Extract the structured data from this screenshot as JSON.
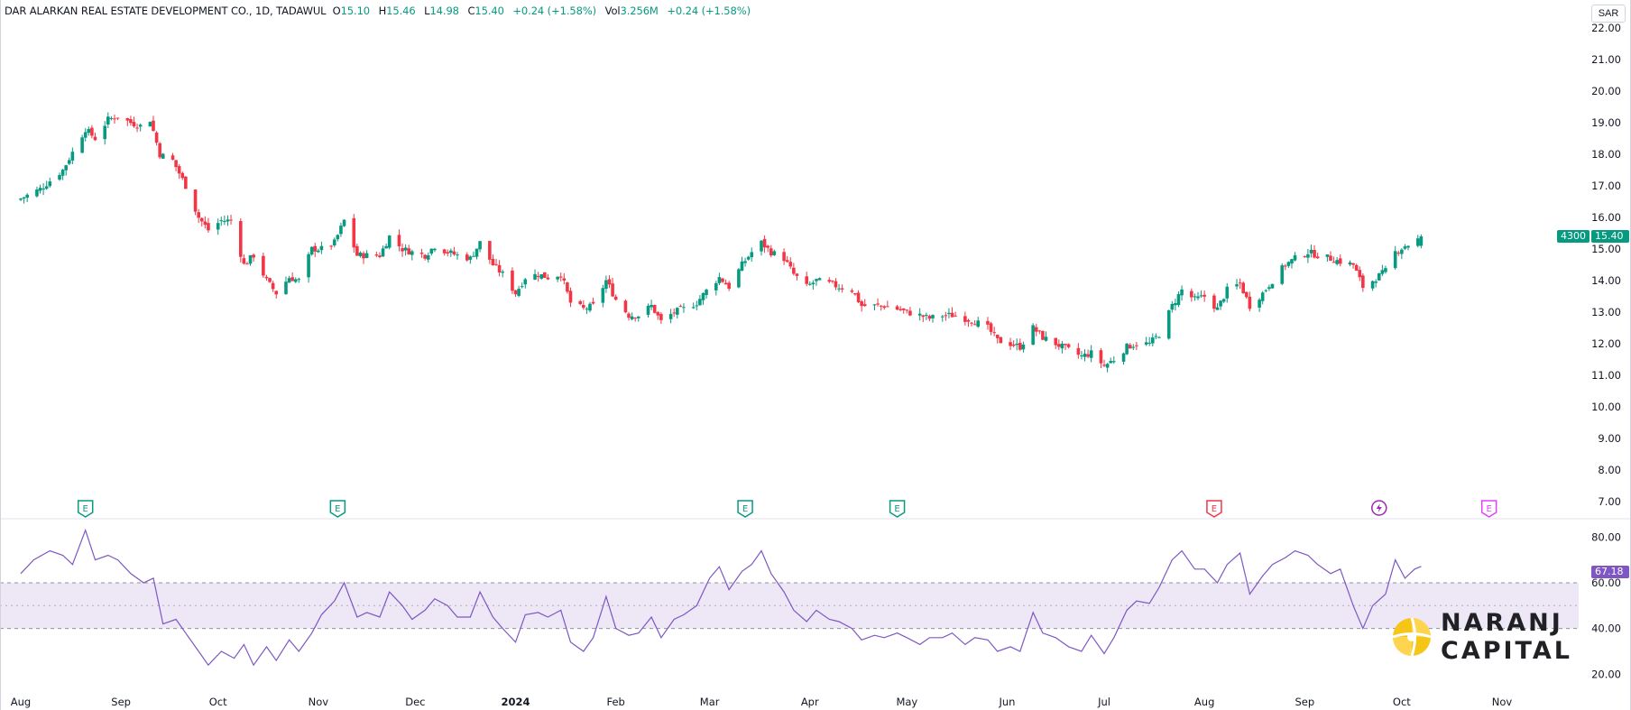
{
  "header": {
    "symbol": "DAR ALARKAN REAL ESTATE DEVELOPMENT CO., 1D, TADAWUL",
    "open_label": "O",
    "open": "15.10",
    "high_label": "H",
    "high": "15.46",
    "low_label": "L",
    "low": "14.98",
    "close_label": "C",
    "close": "15.40",
    "change": "+0.24 (+1.58%)",
    "vol_label": "Vol",
    "vol": "3.256M",
    "vol_change": "+0.24 (+1.58%)"
  },
  "currency": "SAR",
  "price_tag": {
    "ticker": "4300",
    "last": "15.40"
  },
  "rsi_tag": "67.18",
  "brand": {
    "line1": "NARANJ",
    "line2": "CAPITAL"
  },
  "colors": {
    "up": "#089981",
    "down": "#f23645",
    "rsi": "#7e57c2",
    "band": "#ede7f6",
    "event_e_green": "#089981",
    "event_e_red": "#f23645",
    "event_e_magenta": "#e040fb",
    "event_split": "#9c27b0",
    "logo_yellow": "#f5c518"
  },
  "events": [
    {
      "date": "2023-08-21",
      "kind": "E",
      "color": "green"
    },
    {
      "date": "2023-11-07",
      "kind": "E",
      "color": "green"
    },
    {
      "date": "2024-03-12",
      "kind": "E",
      "color": "green"
    },
    {
      "date": "2024-04-28",
      "kind": "E",
      "color": "green"
    },
    {
      "date": "2024-08-04",
      "kind": "E",
      "color": "red"
    },
    {
      "date": "2024-09-24",
      "kind": "dividend-icon",
      "color": "purple"
    },
    {
      "date": "2024-10-28",
      "kind": "E",
      "color": "magenta"
    }
  ],
  "chart_data": [
    {
      "type": "candlestick",
      "title": "DAR ALARKAN REAL ESTATE DEVELOPMENT CO., 1D, TADAWUL",
      "ylim": [
        7,
        22
      ],
      "yticks": [
        "22.00",
        "21.00",
        "20.00",
        "19.00",
        "18.00",
        "17.00",
        "16.00",
        "15.00",
        "14.00",
        "13.00",
        "12.00",
        "11.00",
        "10.00",
        "9.00",
        "8.00",
        "7.00"
      ],
      "xticks": [
        {
          "label": "Aug",
          "date": "2023-08-01"
        },
        {
          "label": "Sep",
          "date": "2023-09-01"
        },
        {
          "label": "Oct",
          "date": "2023-10-01"
        },
        {
          "label": "Nov",
          "date": "2023-11-01"
        },
        {
          "label": "Dec",
          "date": "2023-12-01"
        },
        {
          "label": "2024",
          "date": "2024-01-01"
        },
        {
          "label": "Feb",
          "date": "2024-02-01"
        },
        {
          "label": "Mar",
          "date": "2024-03-01"
        },
        {
          "label": "Apr",
          "date": "2024-04-01"
        },
        {
          "label": "May",
          "date": "2024-05-01"
        },
        {
          "label": "Jun",
          "date": "2024-06-01"
        },
        {
          "label": "Jul",
          "date": "2024-07-01"
        },
        {
          "label": "Aug",
          "date": "2024-08-01"
        },
        {
          "label": "Sep",
          "date": "2024-09-01"
        },
        {
          "label": "Oct",
          "date": "2024-10-01"
        },
        {
          "label": "Nov",
          "date": "2024-11-01"
        }
      ],
      "close_path": [
        [
          "2023-08-01",
          16.6
        ],
        [
          "2023-08-07",
          16.9
        ],
        [
          "2023-08-14",
          17.5
        ],
        [
          "2023-08-21",
          18.8
        ],
        [
          "2023-08-24",
          18.5
        ],
        [
          "2023-08-28",
          19.1
        ],
        [
          "2023-08-31",
          19.2
        ],
        [
          "2023-09-04",
          19.0
        ],
        [
          "2023-09-07",
          18.9
        ],
        [
          "2023-09-10",
          19.1
        ],
        [
          "2023-09-13",
          18.0
        ],
        [
          "2023-09-17",
          17.8
        ],
        [
          "2023-09-21",
          17.0
        ],
        [
          "2023-09-25",
          16.0
        ],
        [
          "2023-09-28",
          15.6
        ],
        [
          "2023-10-02",
          15.9
        ],
        [
          "2023-10-05",
          15.9
        ],
        [
          "2023-10-09",
          14.5
        ],
        [
          "2023-10-12",
          14.8
        ],
        [
          "2023-10-16",
          14.0
        ],
        [
          "2023-10-19",
          13.6
        ],
        [
          "2023-10-23",
          14.1
        ],
        [
          "2023-10-26",
          14.0
        ],
        [
          "2023-10-30",
          15.0
        ],
        [
          "2023-11-02",
          15.0
        ],
        [
          "2023-11-06",
          15.2
        ],
        [
          "2023-11-09",
          15.9
        ],
        [
          "2023-11-13",
          14.8
        ],
        [
          "2023-11-16",
          14.8
        ],
        [
          "2023-11-20",
          14.8
        ],
        [
          "2023-11-23",
          15.4
        ],
        [
          "2023-11-27",
          15.0
        ],
        [
          "2023-11-30",
          14.9
        ],
        [
          "2023-12-04",
          14.8
        ],
        [
          "2023-12-07",
          15.1
        ],
        [
          "2023-12-11",
          14.9
        ],
        [
          "2023-12-14",
          14.8
        ],
        [
          "2023-12-18",
          14.7
        ],
        [
          "2023-12-21",
          15.2
        ],
        [
          "2023-12-25",
          14.5
        ],
        [
          "2023-12-28",
          14.2
        ],
        [
          "2024-01-01",
          13.6
        ],
        [
          "2024-01-04",
          14.1
        ],
        [
          "2024-01-08",
          14.2
        ],
        [
          "2024-01-11",
          14.1
        ],
        [
          "2024-01-15",
          14.2
        ],
        [
          "2024-01-18",
          13.3
        ],
        [
          "2024-01-22",
          13.1
        ],
        [
          "2024-01-25",
          13.2
        ],
        [
          "2024-01-29",
          14.0
        ],
        [
          "2024-02-01",
          13.4
        ],
        [
          "2024-02-05",
          12.9
        ],
        [
          "2024-02-08",
          12.9
        ],
        [
          "2024-02-12",
          13.2
        ],
        [
          "2024-02-15",
          12.7
        ],
        [
          "2024-02-19",
          13.0
        ],
        [
          "2024-02-22",
          13.1
        ],
        [
          "2024-02-26",
          13.3
        ],
        [
          "2024-03-01",
          13.8
        ],
        [
          "2024-03-04",
          14.1
        ],
        [
          "2024-03-07",
          13.8
        ],
        [
          "2024-03-11",
          14.5
        ],
        [
          "2024-03-14",
          14.9
        ],
        [
          "2024-03-17",
          15.2
        ],
        [
          "2024-03-20",
          14.9
        ],
        [
          "2024-03-24",
          14.7
        ],
        [
          "2024-03-27",
          14.2
        ],
        [
          "2024-03-31",
          13.8
        ],
        [
          "2024-04-03",
          14.0
        ],
        [
          "2024-04-07",
          13.9
        ],
        [
          "2024-04-10",
          13.8
        ],
        [
          "2024-04-14",
          13.7
        ],
        [
          "2024-04-17",
          13.2
        ],
        [
          "2024-04-21",
          13.2
        ],
        [
          "2024-04-24",
          13.2
        ],
        [
          "2024-04-28",
          13.1
        ],
        [
          "2024-05-01",
          13.0
        ],
        [
          "2024-05-05",
          12.9
        ],
        [
          "2024-05-08",
          12.8
        ],
        [
          "2024-05-12",
          12.9
        ],
        [
          "2024-05-15",
          12.9
        ],
        [
          "2024-05-19",
          12.8
        ],
        [
          "2024-05-22",
          12.7
        ],
        [
          "2024-05-26",
          12.5
        ],
        [
          "2024-05-29",
          12.1
        ],
        [
          "2024-06-02",
          12.0
        ],
        [
          "2024-06-05",
          11.9
        ],
        [
          "2024-06-09",
          12.5
        ],
        [
          "2024-06-12",
          12.2
        ],
        [
          "2024-06-16",
          12.0
        ],
        [
          "2024-06-20",
          11.8
        ],
        [
          "2024-06-24",
          11.6
        ],
        [
          "2024-06-27",
          11.7
        ],
        [
          "2024-07-01",
          11.3
        ],
        [
          "2024-07-04",
          11.5
        ],
        [
          "2024-07-08",
          11.9
        ],
        [
          "2024-07-11",
          12.0
        ],
        [
          "2024-07-15",
          12.0
        ],
        [
          "2024-07-18",
          12.3
        ],
        [
          "2024-07-22",
          13.2
        ],
        [
          "2024-07-25",
          13.7
        ],
        [
          "2024-07-29",
          13.4
        ],
        [
          "2024-08-01",
          13.5
        ],
        [
          "2024-08-05",
          13.1
        ],
        [
          "2024-08-08",
          13.7
        ],
        [
          "2024-08-12",
          13.9
        ],
        [
          "2024-08-15",
          13.2
        ],
        [
          "2024-08-19",
          13.6
        ],
        [
          "2024-08-22",
          14.0
        ],
        [
          "2024-08-26",
          14.5
        ],
        [
          "2024-08-29",
          14.7
        ],
        [
          "2024-09-02",
          14.9
        ],
        [
          "2024-09-05",
          14.8
        ],
        [
          "2024-09-09",
          14.7
        ],
        [
          "2024-09-12",
          14.6
        ],
        [
          "2024-09-16",
          14.5
        ],
        [
          "2024-09-19",
          13.8
        ],
        [
          "2024-09-22",
          14.0
        ],
        [
          "2024-09-26",
          14.3
        ],
        [
          "2024-09-29",
          14.9
        ],
        [
          "2024-10-02",
          15.1
        ],
        [
          "2024-10-05",
          15.2
        ],
        [
          "2024-10-07",
          15.4
        ]
      ],
      "last_close": 15.4
    },
    {
      "type": "line",
      "title": "RSI",
      "ylim": [
        15,
        88
      ],
      "yticks": [
        "80.00",
        "60.00",
        "40.00",
        "20.00"
      ],
      "band": [
        40,
        60
      ],
      "midline": 50,
      "last_value": 67.18,
      "values": [
        [
          "2023-08-01",
          64
        ],
        [
          "2023-08-05",
          70
        ],
        [
          "2023-08-10",
          74
        ],
        [
          "2023-08-14",
          72
        ],
        [
          "2023-08-17",
          68
        ],
        [
          "2023-08-21",
          83
        ],
        [
          "2023-08-24",
          70
        ],
        [
          "2023-08-28",
          72
        ],
        [
          "2023-08-31",
          70
        ],
        [
          "2023-09-04",
          64
        ],
        [
          "2023-09-08",
          60
        ],
        [
          "2023-09-11",
          62
        ],
        [
          "2023-09-14",
          42
        ],
        [
          "2023-09-18",
          44
        ],
        [
          "2023-09-21",
          38
        ],
        [
          "2023-09-25",
          30
        ],
        [
          "2023-09-28",
          24
        ],
        [
          "2023-10-02",
          30
        ],
        [
          "2023-10-06",
          27
        ],
        [
          "2023-10-09",
          33
        ],
        [
          "2023-10-12",
          24
        ],
        [
          "2023-10-16",
          32
        ],
        [
          "2023-10-19",
          26
        ],
        [
          "2023-10-23",
          35
        ],
        [
          "2023-10-26",
          30
        ],
        [
          "2023-10-30",
          38
        ],
        [
          "2023-11-02",
          46
        ],
        [
          "2023-11-06",
          52
        ],
        [
          "2023-11-09",
          60
        ],
        [
          "2023-11-13",
          45
        ],
        [
          "2023-11-16",
          47
        ],
        [
          "2023-11-20",
          45
        ],
        [
          "2023-11-23",
          56
        ],
        [
          "2023-11-27",
          50
        ],
        [
          "2023-11-30",
          44
        ],
        [
          "2023-12-04",
          48
        ],
        [
          "2023-12-07",
          53
        ],
        [
          "2023-12-11",
          50
        ],
        [
          "2023-12-14",
          45
        ],
        [
          "2023-12-18",
          45
        ],
        [
          "2023-12-21",
          56
        ],
        [
          "2023-12-25",
          45
        ],
        [
          "2023-12-28",
          40
        ],
        [
          "2024-01-01",
          34
        ],
        [
          "2024-01-04",
          46
        ],
        [
          "2024-01-08",
          47
        ],
        [
          "2024-01-11",
          45
        ],
        [
          "2024-01-15",
          48
        ],
        [
          "2024-01-18",
          34
        ],
        [
          "2024-01-22",
          30
        ],
        [
          "2024-01-25",
          36
        ],
        [
          "2024-01-29",
          54
        ],
        [
          "2024-02-01",
          40
        ],
        [
          "2024-02-05",
          37
        ],
        [
          "2024-02-08",
          38
        ],
        [
          "2024-02-12",
          45
        ],
        [
          "2024-02-15",
          36
        ],
        [
          "2024-02-19",
          44
        ],
        [
          "2024-02-22",
          46
        ],
        [
          "2024-02-26",
          50
        ],
        [
          "2024-03-01",
          62
        ],
        [
          "2024-03-04",
          67
        ],
        [
          "2024-03-07",
          57
        ],
        [
          "2024-03-11",
          65
        ],
        [
          "2024-03-14",
          68
        ],
        [
          "2024-03-17",
          74
        ],
        [
          "2024-03-20",
          64
        ],
        [
          "2024-03-24",
          56
        ],
        [
          "2024-03-27",
          48
        ],
        [
          "2024-03-31",
          43
        ],
        [
          "2024-04-03",
          48
        ],
        [
          "2024-04-07",
          44
        ],
        [
          "2024-04-10",
          43
        ],
        [
          "2024-04-14",
          40
        ],
        [
          "2024-04-17",
          35
        ],
        [
          "2024-04-21",
          37
        ],
        [
          "2024-04-24",
          36
        ],
        [
          "2024-04-28",
          38
        ],
        [
          "2024-05-01",
          36
        ],
        [
          "2024-05-05",
          33
        ],
        [
          "2024-05-08",
          36
        ],
        [
          "2024-05-12",
          36
        ],
        [
          "2024-05-15",
          38
        ],
        [
          "2024-05-19",
          33
        ],
        [
          "2024-05-22",
          36
        ],
        [
          "2024-05-26",
          35
        ],
        [
          "2024-05-29",
          30
        ],
        [
          "2024-06-02",
          32
        ],
        [
          "2024-06-05",
          30
        ],
        [
          "2024-06-09",
          47
        ],
        [
          "2024-06-12",
          38
        ],
        [
          "2024-06-16",
          36
        ],
        [
          "2024-06-20",
          32
        ],
        [
          "2024-06-24",
          30
        ],
        [
          "2024-06-27",
          37
        ],
        [
          "2024-07-01",
          29
        ],
        [
          "2024-07-04",
          36
        ],
        [
          "2024-07-08",
          48
        ],
        [
          "2024-07-11",
          52
        ],
        [
          "2024-07-15",
          51
        ],
        [
          "2024-07-18",
          58
        ],
        [
          "2024-07-22",
          70
        ],
        [
          "2024-07-25",
          74
        ],
        [
          "2024-07-29",
          66
        ],
        [
          "2024-08-01",
          66
        ],
        [
          "2024-08-05",
          60
        ],
        [
          "2024-08-08",
          68
        ],
        [
          "2024-08-12",
          73
        ],
        [
          "2024-08-15",
          55
        ],
        [
          "2024-08-19",
          63
        ],
        [
          "2024-08-22",
          68
        ],
        [
          "2024-08-26",
          71
        ],
        [
          "2024-08-29",
          74
        ],
        [
          "2024-09-02",
          72
        ],
        [
          "2024-09-05",
          68
        ],
        [
          "2024-09-09",
          64
        ],
        [
          "2024-09-12",
          66
        ],
        [
          "2024-09-16",
          50
        ],
        [
          "2024-09-19",
          40
        ],
        [
          "2024-09-22",
          50
        ],
        [
          "2024-09-26",
          55
        ],
        [
          "2024-09-29",
          70
        ],
        [
          "2024-10-02",
          62
        ],
        [
          "2024-10-05",
          66
        ],
        [
          "2024-10-07",
          67.18
        ]
      ]
    }
  ]
}
